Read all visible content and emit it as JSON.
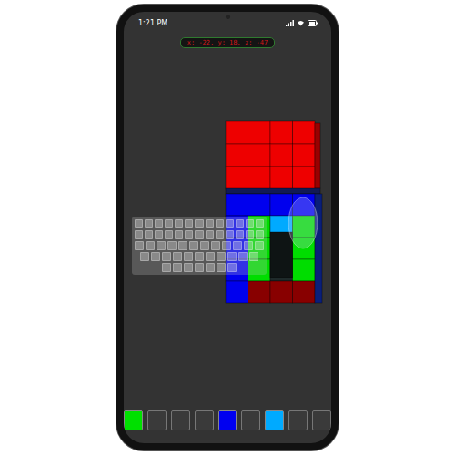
{
  "status_bar": {
    "time": "1:21 PM"
  },
  "coordinates": "x: -22, y: 18, z: -47",
  "hotbar": [
    {
      "filled": true,
      "color": "#00e000"
    },
    {
      "filled": false
    },
    {
      "filled": false
    },
    {
      "filled": false
    },
    {
      "filled": true,
      "color": "#0000f0"
    },
    {
      "filled": false
    },
    {
      "filled": true,
      "color": "#00aaff"
    },
    {
      "filled": false
    },
    {
      "filled": false
    }
  ]
}
